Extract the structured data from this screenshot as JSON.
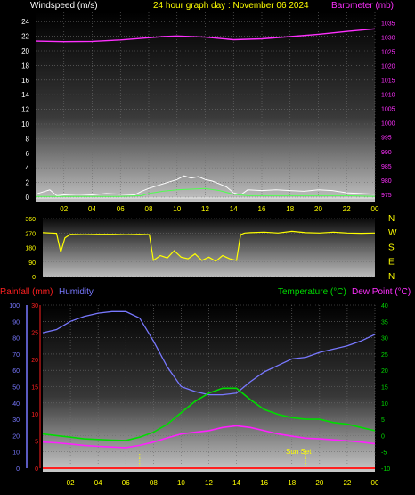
{
  "header": {
    "left_title": "Windspeed (m/s)",
    "center_title": "24 hour graph day : November 06 2024",
    "right_title": "Barometer (mb)"
  },
  "colors": {
    "windspeed": "#ffffff",
    "wind_gust": "#50ff50",
    "barometer": "#ff30ff",
    "direction": "#ffff00",
    "humidity": "#7878ff",
    "temperature": "#00dd00",
    "dew_point": "#ff20ff",
    "rainfall": "#ff2020",
    "axis_labels_bottom": "#ffff00"
  },
  "chart_data": [
    {
      "type": "line",
      "title": "24 hour graph day : November 06 2024",
      "x_ticks": [
        "02",
        "04",
        "06",
        "08",
        "10",
        "12",
        "14",
        "16",
        "18",
        "20",
        "22",
        "00"
      ],
      "y_left_label": "Windspeed (m/s)",
      "y_left_ticks": [
        "0",
        "2",
        "4",
        "6",
        "8",
        "10",
        "12",
        "14",
        "16",
        "18",
        "20",
        "22",
        "24"
      ],
      "y_left_range": [
        0,
        25
      ],
      "y_right_label": "Barometer (mb)",
      "y_right_ticks": [
        "975",
        "980",
        "985",
        "990",
        "995",
        "1000",
        "1005",
        "1010",
        "1015",
        "1020",
        "1025",
        "1030",
        "1035"
      ],
      "y_right_range": [
        974,
        1038
      ],
      "grid": true,
      "series": [
        {
          "name": "Barometer (mb)",
          "axis": "right",
          "x": [
            0,
            2,
            4,
            6,
            8,
            9,
            10,
            12,
            14,
            16,
            18,
            20,
            22,
            24
          ],
          "y": [
            1028.6,
            1028.4,
            1028.5,
            1029.0,
            1029.8,
            1030.2,
            1030.4,
            1030.0,
            1029.1,
            1029.4,
            1030.2,
            1031.0,
            1032.0,
            1032.9
          ]
        },
        {
          "name": "Wind gust",
          "axis": "left",
          "x": [
            0,
            1,
            1.5,
            2,
            3,
            4,
            5,
            6,
            7,
            7.5,
            8,
            9,
            10,
            10.5,
            11,
            11.5,
            12,
            12.5,
            13,
            13.5,
            14,
            14.5,
            15,
            16,
            17,
            18,
            19,
            20,
            21,
            22,
            23,
            24
          ],
          "y": [
            0.4,
            1.0,
            0.2,
            0.3,
            0.4,
            0.3,
            0.5,
            0.4,
            0.3,
            0.8,
            1.2,
            1.8,
            2.4,
            2.9,
            2.6,
            2.8,
            2.4,
            2.2,
            1.8,
            1.4,
            0.6,
            0.3,
            1.0,
            0.9,
            1.0,
            0.9,
            0.8,
            1.0,
            0.9,
            0.6,
            0.5,
            0.4
          ]
        },
        {
          "name": "Windspeed",
          "axis": "left",
          "x": [
            0,
            2,
            4,
            6,
            7.5,
            8,
            9,
            10,
            11,
            12,
            13,
            14,
            15,
            16,
            18,
            20,
            22,
            24
          ],
          "y": [
            0.1,
            0.1,
            0.1,
            0.1,
            0.2,
            0.5,
            0.8,
            1.0,
            1.1,
            1.2,
            0.9,
            0.4,
            0.2,
            0.2,
            0.2,
            0.2,
            0.2,
            0.1
          ]
        }
      ]
    },
    {
      "type": "line",
      "y_left_ticks": [
        "0",
        "90",
        "180",
        "270",
        "360"
      ],
      "y_left_range": [
        0,
        360
      ],
      "y_right_ticks": [
        "N",
        "W",
        "S",
        "E",
        "N"
      ],
      "grid": true,
      "series": [
        {
          "name": "Wind direction",
          "axis": "left",
          "x": [
            0,
            0.6,
            1,
            1.3,
            1.6,
            2,
            3,
            4,
            5,
            6,
            7,
            7.7,
            8,
            8.5,
            9,
            9.5,
            10,
            10.5,
            11,
            11.5,
            12,
            12.5,
            13,
            13.5,
            14,
            14.3,
            14.6,
            15,
            16,
            17,
            18,
            19,
            20,
            21,
            22,
            23,
            24
          ],
          "y": [
            272,
            270,
            268,
            150,
            240,
            262,
            260,
            262,
            262,
            260,
            262,
            260,
            100,
            130,
            115,
            160,
            120,
            110,
            140,
            100,
            120,
            95,
            130,
            110,
            100,
            260,
            270,
            272,
            275,
            270,
            280,
            272,
            270,
            275,
            270,
            268,
            270
          ]
        }
      ]
    },
    {
      "type": "line",
      "x_ticks": [
        "02",
        "04",
        "06",
        "08",
        "10",
        "12",
        "14",
        "16",
        "18",
        "20",
        "22",
        "00"
      ],
      "y_humidity_label": "Humidity",
      "y_humidity_ticks": [
        "0",
        "10",
        "20",
        "30",
        "40",
        "50",
        "60",
        "70",
        "80",
        "90",
        "100"
      ],
      "y_humidity_range": [
        0,
        100
      ],
      "y_rain_label": "Rainfall (mm)",
      "y_rain_ticks": [
        "0",
        "5",
        "10",
        "15",
        "20",
        "25",
        "30"
      ],
      "y_rain_range": [
        0,
        30
      ],
      "y_temp_label": "Temperature (°C)",
      "y_dew_label": "Dew Point (°C)",
      "y_temp_ticks": [
        "-10",
        "-5",
        "0",
        "5",
        "10",
        "15",
        "20",
        "25",
        "30",
        "35",
        "40"
      ],
      "y_temp_range": [
        -10,
        40
      ],
      "annotation": "Sun Set",
      "grid": true,
      "series": [
        {
          "name": "Humidity",
          "axis": "humidity",
          "x": [
            0,
            1,
            2,
            3,
            4,
            5,
            6,
            7,
            8,
            9,
            10,
            11,
            12,
            13,
            14,
            15,
            16,
            17,
            18,
            19,
            20,
            21,
            22,
            23,
            24
          ],
          "y": [
            83,
            85,
            90,
            93,
            95,
            96,
            96,
            92,
            78,
            62,
            50,
            47,
            45,
            45,
            46,
            53,
            59,
            63,
            67,
            68,
            71,
            73,
            75,
            78,
            82
          ]
        },
        {
          "name": "Temperature (°C)",
          "axis": "temp",
          "x": [
            0,
            1,
            2,
            3,
            4,
            5,
            6,
            7,
            8,
            9,
            10,
            11,
            12,
            13,
            14,
            15,
            16,
            17,
            18,
            19,
            20,
            21,
            22,
            23,
            24
          ],
          "y": [
            0.5,
            0,
            -0.5,
            -1,
            -1.2,
            -1.4,
            -1.5,
            -0.5,
            1,
            3.5,
            7,
            10.5,
            13,
            14.5,
            14.5,
            11,
            8,
            6.5,
            5.5,
            5,
            5,
            4,
            3.5,
            2.5,
            1.5
          ]
        },
        {
          "name": "Dew Point (°C)",
          "axis": "temp",
          "x": [
            0,
            1,
            2,
            3,
            4,
            5,
            6,
            7,
            8,
            9,
            10,
            11,
            12,
            13,
            14,
            15,
            16,
            17,
            18,
            19,
            20,
            21,
            22,
            23,
            24
          ],
          "y": [
            -2,
            -2.2,
            -2.6,
            -3,
            -3.3,
            -3.5,
            -3.7,
            -3,
            -2,
            -0.7,
            0.5,
            1,
            1.5,
            2.5,
            3,
            2.5,
            1.5,
            0.5,
            -0.2,
            -0.8,
            -1,
            -1.3,
            -1.6,
            -2,
            -2.5
          ]
        },
        {
          "name": "Rainfall (mm)",
          "axis": "rain",
          "x": [
            0,
            24
          ],
          "y": [
            0,
            0
          ]
        }
      ]
    }
  ]
}
